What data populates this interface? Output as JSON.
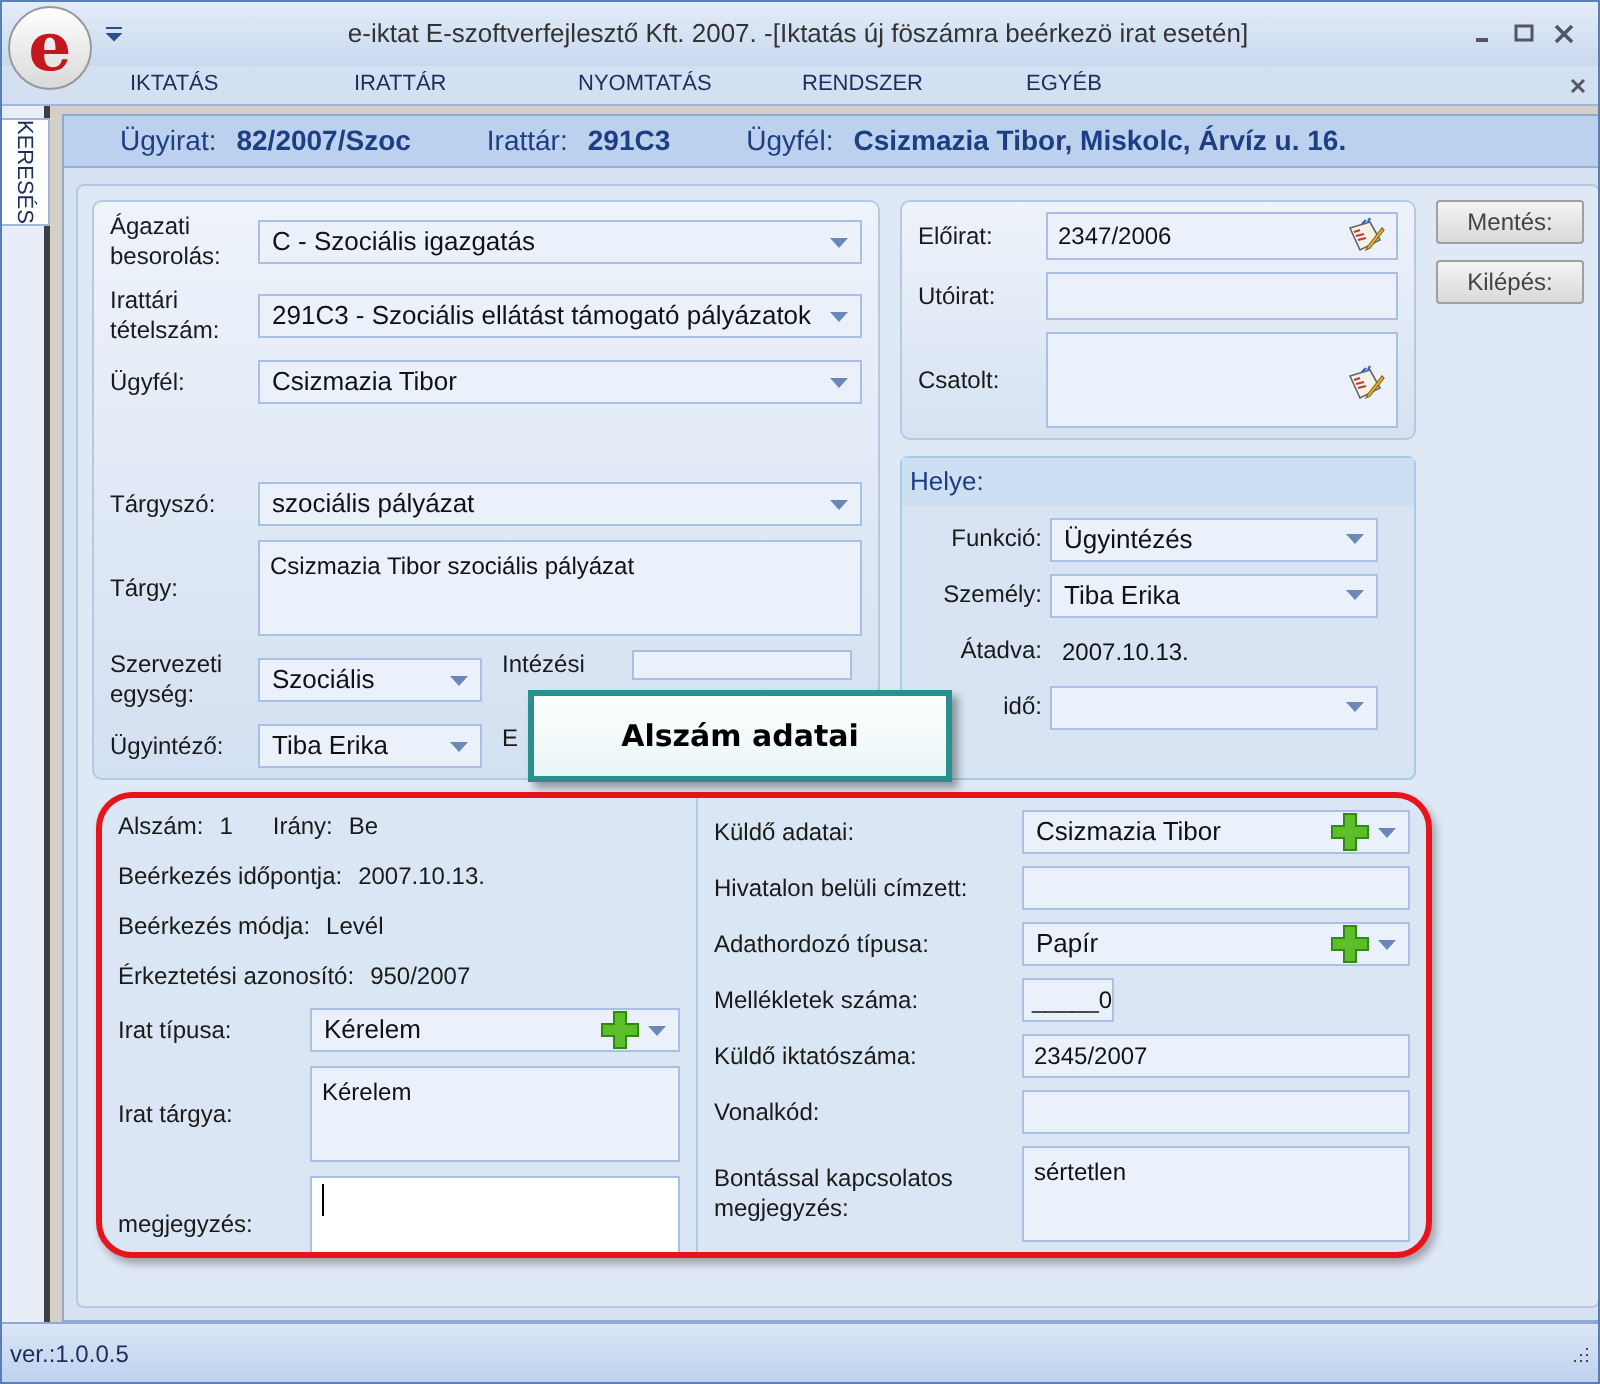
{
  "window": {
    "logo": "e",
    "title": "e-iktat E-szoftverfejlesztő Kft. 2007. -[Iktatás új föszámra beérkezö irat esetén]"
  },
  "menu": [
    "IKTATÁS",
    "IRATTÁR",
    "NYOMTATÁS",
    "RENDSZER",
    "EGYÉB"
  ],
  "side_tab": {
    "label": "KERESÉS"
  },
  "header": [
    {
      "label": "Ügyirat:",
      "value": "82/2007/Szoc"
    },
    {
      "label": "Irattár:",
      "value": "291C3"
    },
    {
      "label": "Ügyfél:",
      "value": "Csizmazia Tibor, Miskolc, Árvíz u. 16."
    }
  ],
  "subject": {
    "rows": [
      {
        "kind": "select",
        "label": "Ágazati besorolás:",
        "value": "C - Szociális igazgatás"
      },
      {
        "kind": "select",
        "label": "Irattári tételszám:",
        "value": "291C3 - Szociális ellátást támogató pályázatok"
      },
      {
        "kind": "select",
        "label": "Ügyfél:",
        "value": "Csizmazia Tibor"
      },
      {
        "kind": "spacer"
      },
      {
        "kind": "select",
        "label": "Tárgyszó:",
        "value": "szociális pályázat"
      },
      {
        "kind": "textarea",
        "label": "Tárgy:",
        "value": "Csizmazia Tibor szociális pályázat"
      }
    ],
    "pairs": [
      {
        "label": "Szervezeti egység:",
        "value": "Szociális",
        "side_label": "Intézési",
        "side_field": true
      },
      {
        "label": "Ügyintéző:",
        "value": "Tiba Erika",
        "side_label": "E"
      }
    ]
  },
  "refs": [
    {
      "kind": "text",
      "label": "Előirat:",
      "value": "2347/2006",
      "picker": true
    },
    {
      "kind": "text",
      "label": "Utóirat:",
      "picker": false
    },
    {
      "kind": "textarea",
      "label": "Csatolt:",
      "picker": true
    }
  ],
  "location": {
    "title": "Helye:",
    "rows": [
      {
        "kind": "select",
        "label": "Funkció:",
        "value": "Ügyintézés"
      },
      {
        "kind": "select",
        "label": "Személy:",
        "value": "Tiba Erika"
      },
      {
        "kind": "static",
        "label": "Átadva:",
        "value": "2007.10.13."
      },
      {
        "kind": "select",
        "label": "idő:"
      }
    ]
  },
  "buttons": [
    "Mentés:",
    "Kilépés:"
  ],
  "callout": "Alszám adatai",
  "sub": {
    "info": [
      [
        {
          "label": "Alszám:",
          "value": "1"
        },
        {
          "label": "Irány:",
          "value": "Be"
        }
      ],
      [
        {
          "label": "Beérkezés időpontja:",
          "value": "2007.10.13."
        }
      ],
      [
        {
          "label": "Beérkezés módja:",
          "value": "Levél"
        }
      ],
      [
        {
          "label": "Érkeztetési azonosító:",
          "value": "950/2007"
        }
      ]
    ],
    "fields": [
      {
        "kind": "select_add",
        "label": "Irat típusa:",
        "value": "Kérelem"
      },
      {
        "kind": "textarea",
        "label": "Irat tárgya:",
        "value": "Kérelem"
      },
      {
        "kind": "textarea",
        "label": "megjegyzés:",
        "focused": true
      }
    ]
  },
  "sender": [
    {
      "kind": "select_add",
      "label": "Küldő adatai:",
      "value": "Csizmazia Tibor"
    },
    {
      "kind": "text",
      "label": "Hivatalon belüli címzett:"
    },
    {
      "kind": "select_add",
      "label": "Adathordozó típusa:",
      "value": "Papír"
    },
    {
      "kind": "number",
      "label": "Mellékletek száma:",
      "value": "_____0"
    },
    {
      "kind": "text",
      "label": "Küldő iktatószáma:",
      "value": "2345/2007"
    },
    {
      "kind": "text",
      "label": "Vonalkód:"
    },
    {
      "kind": "textarea",
      "label": "Bontással kapcsolatos megjegyzés:",
      "value": "sértetlen"
    }
  ],
  "status_bar": {
    "version": "ver.:1.0.0.5"
  }
}
